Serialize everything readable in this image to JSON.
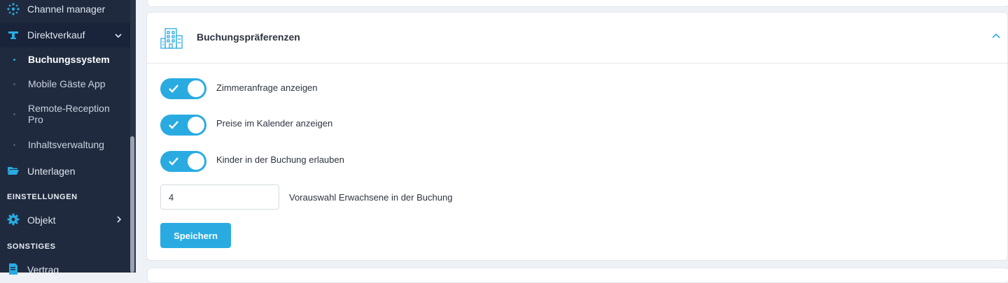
{
  "sidebar": {
    "items": [
      {
        "label": "Channel manager",
        "icon": "network-icon"
      },
      {
        "label": "Direktverkauf",
        "icon": "reception-bell-icon"
      },
      {
        "label": "Unterlagen",
        "icon": "folder-open-icon"
      },
      {
        "label": "Objekt",
        "icon": "gear-icon"
      },
      {
        "label": "Vertrag",
        "icon": "document-icon"
      }
    ],
    "subitems": [
      {
        "label": "Buchungssystem",
        "active": true
      },
      {
        "label": "Mobile Gäste App",
        "active": false
      },
      {
        "label": "Remote-Reception Pro",
        "active": false
      },
      {
        "label": "Inhaltsverwaltung",
        "active": false
      }
    ],
    "sections": {
      "settings": "EINSTELLUNGEN",
      "other": "SONSTIGES"
    }
  },
  "panel": {
    "title": "Buchungspräferenzen",
    "icon": "hotel-building-icon",
    "options": [
      {
        "label": "Zimmeranfrage anzeigen",
        "enabled": true
      },
      {
        "label": "Preise im Kalender anzeigen",
        "enabled": true
      },
      {
        "label": "Kinder in der Buchung erlauben",
        "enabled": true
      }
    ],
    "adults_default": {
      "value": "4",
      "label": "Vorauswahl Erwachsene in der Buchung"
    },
    "save_label": "Speichern"
  },
  "colors": {
    "accent": "#29abe2",
    "sidebar_bg": "#1f2a3e",
    "page_bg": "#eef1f5"
  }
}
